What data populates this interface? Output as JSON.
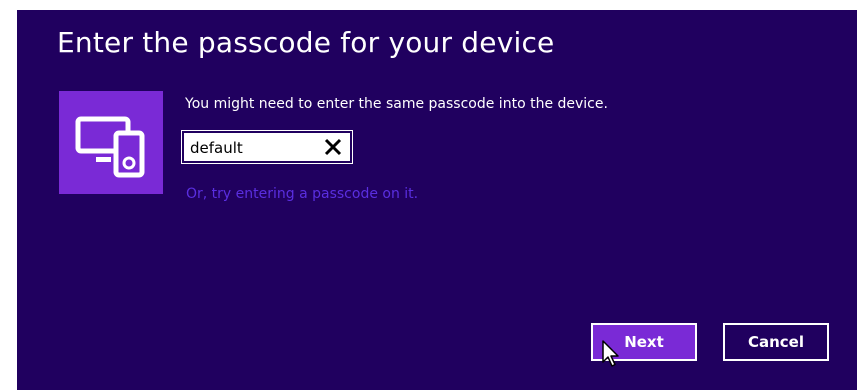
{
  "dialog": {
    "title": "Enter the passcode for your device",
    "message": "You might need to enter the same passcode into the device.",
    "passcode": {
      "value": "default",
      "placeholder": ""
    },
    "alternate_link": "Or, try entering a passcode on it.",
    "buttons": {
      "next_label": "Next",
      "cancel_label": "Cancel"
    }
  },
  "colors": {
    "background": "#20005f",
    "accent": "#7a2ad6",
    "link": "#5a2ee0",
    "text": "#ffffff"
  },
  "icons": {
    "device": "pc-and-media-player-icon",
    "clear": "close-icon",
    "cursor": "mouse-pointer-icon"
  }
}
